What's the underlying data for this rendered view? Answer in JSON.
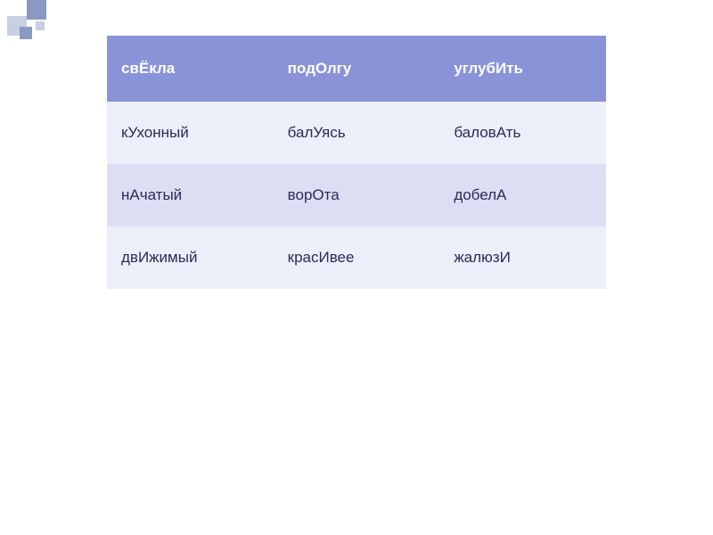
{
  "table": {
    "header": [
      "свЁкла",
      "подОлгу",
      "углубИть"
    ],
    "rows": [
      [
        "кУхонный",
        "балУясь",
        "баловАть"
      ],
      [
        "нАчатый",
        "ворОта",
        "добелА"
      ],
      [
        "двИжимый",
        "красИвее",
        "жалюзИ"
      ]
    ]
  }
}
